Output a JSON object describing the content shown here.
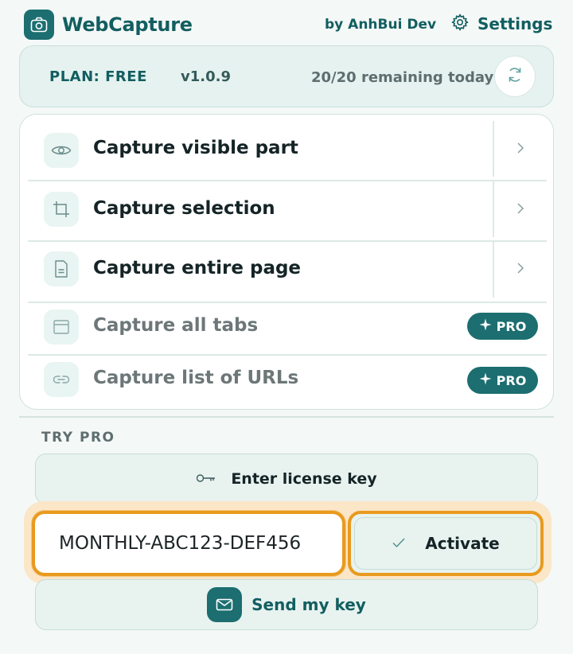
{
  "header": {
    "app_title": "WebCapture",
    "by_line": "by AnhBui Dev",
    "settings_label": "Settings"
  },
  "plan": {
    "plan_label": "PLAN: FREE",
    "version": "v1.0.9",
    "remaining": "20/20 remaining today"
  },
  "capture_options": [
    {
      "label": "Capture visible part",
      "icon": "eye-icon",
      "enabled": true
    },
    {
      "label": "Capture selection",
      "icon": "crop-icon",
      "enabled": true
    },
    {
      "label": "Capture entire page",
      "icon": "document-icon",
      "enabled": true
    },
    {
      "label": "Capture all tabs",
      "icon": "tab-window-icon",
      "enabled": false,
      "badge": "PRO"
    },
    {
      "label": "Capture list of URLs",
      "icon": "link-icon",
      "enabled": false,
      "badge": "PRO"
    }
  ],
  "try_pro": {
    "section_title": "TRY PRO",
    "license_button_label": "Enter license key",
    "license_key_value": "MONTHLY-ABC123-DEF456",
    "activate_label": "Activate",
    "send_key_label": "Send my key"
  },
  "colors": {
    "brand": "#1c6e70",
    "brand_text": "#125e60",
    "highlight": "#e99a1e",
    "highlight_glow": "#fbe6c7",
    "surface": "#e8f3f0"
  }
}
